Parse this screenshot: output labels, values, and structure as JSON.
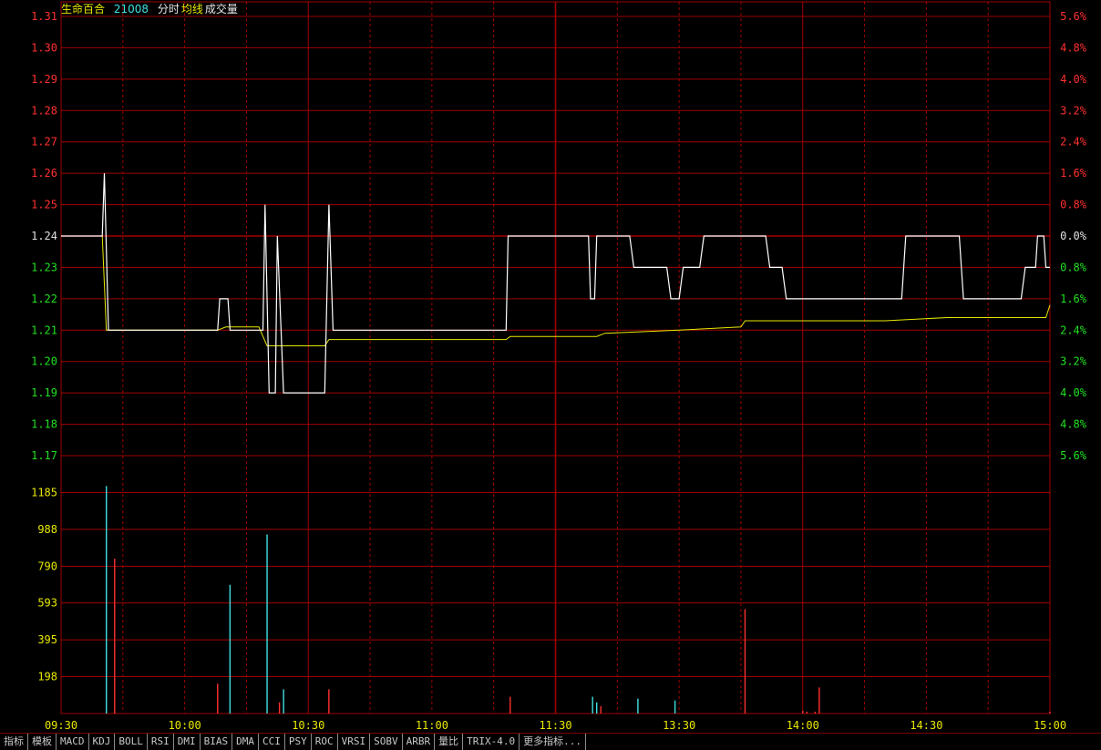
{
  "header": {
    "name": "生命百合",
    "code": "21008",
    "labels": [
      "分时",
      "均线",
      "成交量"
    ]
  },
  "colors": {
    "grid": "#a00000",
    "up": "#ff3030",
    "down": "#20e020",
    "flat": "#e0e0e0",
    "price_line": "#ffffff",
    "avg_line": "#e8e800",
    "volume_axis": "#e8e800",
    "volume_up": "#ff3030",
    "volume_down": "#40e0e0",
    "name_color": "#e8e800",
    "code_color": "#40e0e0"
  },
  "chart_data": {
    "type": "line",
    "prev_close": 1.24,
    "price_ticks": [
      "1.31",
      "1.30",
      "1.29",
      "1.28",
      "1.27",
      "1.26",
      "1.25",
      "1.24",
      "1.23",
      "1.22",
      "1.21",
      "1.20",
      "1.19",
      "1.18",
      "1.17"
    ],
    "pct_ticks": [
      "5.6%",
      "4.8%",
      "4.0%",
      "3.2%",
      "2.4%",
      "1.6%",
      "0.8%",
      "0.0%",
      "0.8%",
      "1.6%",
      "2.4%",
      "3.2%",
      "4.0%",
      "4.8%",
      "5.6%"
    ],
    "volume_ticks": [
      "1185",
      "988",
      "790",
      "593",
      "395",
      "198"
    ],
    "volume_max": 1383,
    "time_ticks": [
      "09:30",
      "10:00",
      "10:30",
      "11:00",
      "11:30",
      "13:30",
      "14:00",
      "14:30",
      "15:00"
    ],
    "minutes_total": 240,
    "price_series": [
      [
        0,
        1.24
      ],
      [
        10,
        1.24
      ],
      [
        10.5,
        1.26
      ],
      [
        11.5,
        1.21
      ],
      [
        38,
        1.21
      ],
      [
        38.5,
        1.22
      ],
      [
        40.5,
        1.22
      ],
      [
        41,
        1.21
      ],
      [
        49,
        1.21
      ],
      [
        49.5,
        1.25
      ],
      [
        50.5,
        1.19
      ],
      [
        52,
        1.19
      ],
      [
        52.5,
        1.24
      ],
      [
        54,
        1.19
      ],
      [
        64,
        1.19
      ],
      [
        65,
        1.25
      ],
      [
        66,
        1.21
      ],
      [
        108,
        1.21
      ],
      [
        108.5,
        1.24
      ],
      [
        128,
        1.24
      ],
      [
        128.5,
        1.22
      ],
      [
        129.5,
        1.22
      ],
      [
        130,
        1.24
      ],
      [
        138,
        1.24
      ],
      [
        139,
        1.23
      ],
      [
        147,
        1.23
      ],
      [
        148,
        1.22
      ],
      [
        150,
        1.22
      ],
      [
        151,
        1.23
      ],
      [
        155,
        1.23
      ],
      [
        156,
        1.24
      ],
      [
        171,
        1.24
      ],
      [
        172,
        1.23
      ],
      [
        175,
        1.23
      ],
      [
        176,
        1.22
      ],
      [
        204,
        1.22
      ],
      [
        205,
        1.24
      ],
      [
        218,
        1.24
      ],
      [
        219,
        1.22
      ],
      [
        233,
        1.22
      ],
      [
        234,
        1.23
      ],
      [
        236.5,
        1.23
      ],
      [
        237,
        1.24
      ],
      [
        238.5,
        1.24
      ],
      [
        239,
        1.23
      ],
      [
        240,
        1.23
      ]
    ],
    "avg_series": [
      [
        0,
        1.24
      ],
      [
        10,
        1.24
      ],
      [
        11,
        1.21
      ],
      [
        38,
        1.21
      ],
      [
        40,
        1.211
      ],
      [
        48,
        1.211
      ],
      [
        50,
        1.205
      ],
      [
        52,
        1.205
      ],
      [
        54,
        1.205
      ],
      [
        64,
        1.205
      ],
      [
        65,
        1.207
      ],
      [
        108,
        1.207
      ],
      [
        109,
        1.208
      ],
      [
        130,
        1.208
      ],
      [
        132,
        1.209
      ],
      [
        150,
        1.21
      ],
      [
        165,
        1.211
      ],
      [
        166,
        1.213
      ],
      [
        200,
        1.213
      ],
      [
        215,
        1.214
      ],
      [
        239,
        1.214
      ],
      [
        240,
        1.218
      ]
    ],
    "volume_bars": [
      [
        11,
        1220,
        "down"
      ],
      [
        13,
        830,
        "up"
      ],
      [
        38,
        160,
        "up"
      ],
      [
        41,
        690,
        "down"
      ],
      [
        50,
        960,
        "down"
      ],
      [
        53,
        60,
        "up"
      ],
      [
        54,
        130,
        "down"
      ],
      [
        65,
        130,
        "up"
      ],
      [
        109,
        90,
        "up"
      ],
      [
        129,
        90,
        "down"
      ],
      [
        130,
        60,
        "down"
      ],
      [
        131,
        40,
        "up"
      ],
      [
        140,
        80,
        "down"
      ],
      [
        149,
        70,
        "down"
      ],
      [
        166,
        560,
        "up"
      ],
      [
        180,
        15,
        "up"
      ],
      [
        181,
        10,
        "up"
      ],
      [
        183,
        10,
        "up"
      ],
      [
        184,
        140,
        "up"
      ],
      [
        240,
        10,
        "up"
      ]
    ]
  },
  "tabs": [
    "指标",
    "模板",
    "MACD",
    "KDJ",
    "BOLL",
    "RSI",
    "DMI",
    "BIAS",
    "DMA",
    "CCI",
    "PSY",
    "ROC",
    "VRSI",
    "SOBV",
    "ARBR",
    "量比",
    "TRIX-4.0",
    "更多指标..."
  ]
}
